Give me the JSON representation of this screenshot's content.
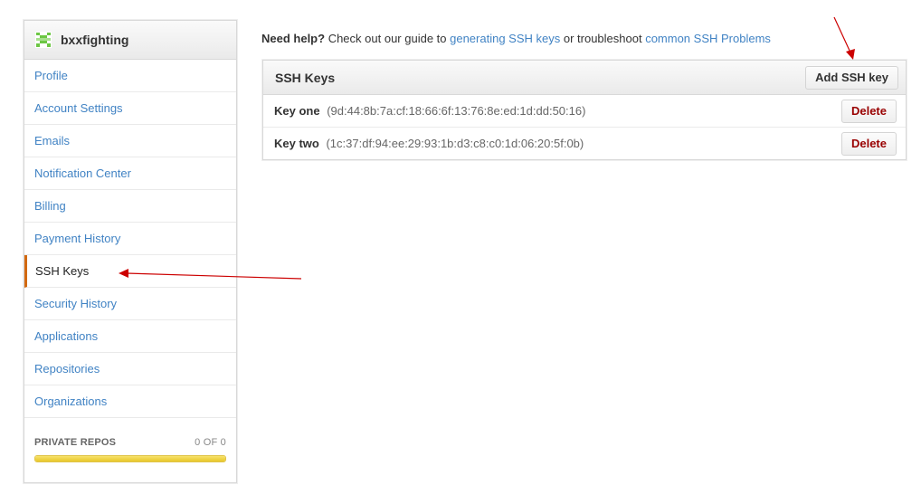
{
  "sidebar": {
    "username": "bxxfighting",
    "items": [
      {
        "label": "Profile"
      },
      {
        "label": "Account Settings"
      },
      {
        "label": "Emails"
      },
      {
        "label": "Notification Center"
      },
      {
        "label": "Billing"
      },
      {
        "label": "Payment History"
      },
      {
        "label": "SSH Keys",
        "selected": true
      },
      {
        "label": "Security History"
      },
      {
        "label": "Applications"
      },
      {
        "label": "Repositories"
      },
      {
        "label": "Organizations"
      }
    ],
    "plan": {
      "label": "PRIVATE REPOS",
      "count": "0 OF 0",
      "progress": 1.0
    }
  },
  "help": {
    "prefix": "Need help?",
    "text1": " Check out our guide to ",
    "link1": "generating SSH keys",
    "text2": " or troubleshoot ",
    "link2": "common SSH Problems"
  },
  "keys": {
    "title": "SSH Keys",
    "add_label": "Add SSH key",
    "delete_label": "Delete",
    "items": [
      {
        "name": "Key one",
        "fingerprint": "(9d:44:8b:7a:cf:18:66:6f:13:76:8e:ed:1d:dd:50:16)"
      },
      {
        "name": "Key two",
        "fingerprint": "(1c:37:df:94:ee:29:93:1b:d3:c8:c0:1d:06:20:5f:0b)"
      }
    ]
  },
  "colors": {
    "link": "#4183c4",
    "selected_marker": "#d26911",
    "delete_text": "#990000",
    "annotation_arrow": "#cc0000",
    "progress_fill": "#f0d444"
  }
}
